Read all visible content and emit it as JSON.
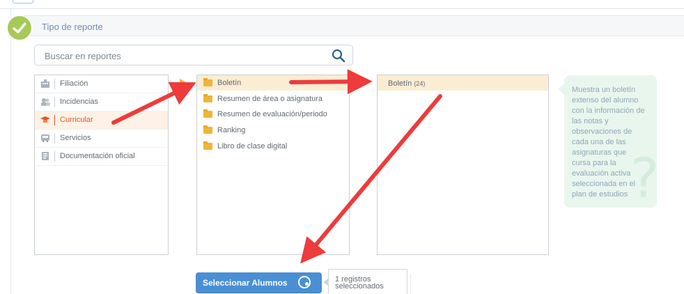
{
  "section": {
    "title": "Tipo de reporte"
  },
  "search": {
    "placeholder": "Buscar en reportes"
  },
  "categories": [
    {
      "label": "Filiación",
      "icon": "building-icon"
    },
    {
      "label": "Incidencias",
      "icon": "users-icon"
    },
    {
      "label": "Curricular",
      "icon": "graduation-cap-icon"
    },
    {
      "label": "Servicios",
      "icon": "bus-icon"
    },
    {
      "label": "Documentación oficial",
      "icon": "document-icon"
    }
  ],
  "reports": [
    {
      "label": "Boletín"
    },
    {
      "label": "Resumen de área o asignatura"
    },
    {
      "label": "Resumen de evaluación/periodo"
    },
    {
      "label": "Ranking"
    },
    {
      "label": "Libro de clase digital"
    }
  ],
  "formats": {
    "label": "Boletín",
    "count": "(24)"
  },
  "help": {
    "lines": [
      "Muestra un boletín",
      "extenso del alumno",
      "con la información de",
      "las notas y",
      "observaciones de",
      "cada una de las",
      "asignaturas que",
      "cursa para la",
      "evaluación activa",
      "seleccionada en el",
      "plan de estudios"
    ],
    "watermark": "?"
  },
  "action": {
    "button_label": "Seleccionar Alumnos",
    "records_line1": "1 registros",
    "records_line2": "seleccionados"
  },
  "colors": {
    "accent": "#4a8fd4",
    "active_text": "#e8532e",
    "selection_bg": "#fbedd3",
    "annotation_arrow": "#ee3b3b",
    "check": "#a7c958"
  }
}
